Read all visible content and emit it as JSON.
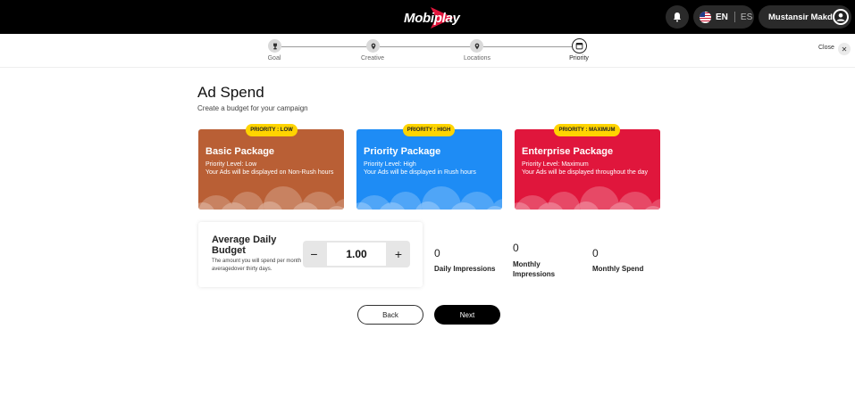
{
  "header": {
    "logo_text": "Mobiplay",
    "notifications_icon": "bell-icon",
    "language": {
      "active": "EN",
      "other": "ES",
      "flag_icon": "us-flag-icon"
    },
    "user": {
      "name": "Mustansir Makda",
      "avatar_icon": "user-avatar-icon"
    }
  },
  "stepper": {
    "steps": [
      {
        "label": "Goal",
        "icon": "trophy-icon",
        "state": "done"
      },
      {
        "label": "Creative",
        "icon": "location-pin-icon",
        "state": "done"
      },
      {
        "label": "Locations",
        "icon": "location-pin-icon",
        "state": "done"
      },
      {
        "label": "Priority",
        "icon": "calendar-icon",
        "state": "active"
      }
    ],
    "close_label": "Close",
    "close_icon": "close-icon"
  },
  "page": {
    "title": "Ad Spend",
    "subtitle": "Create a budget for your campaign"
  },
  "packages": [
    {
      "badge": "PRIORITY : LOW",
      "name": "Basic Package",
      "level": "Priority Level: Low",
      "description": "Your Ads will be displayed on Non-Rush hours",
      "color": "#b95f35"
    },
    {
      "badge": "PRIORITY : HIGH",
      "name": "Priority Package",
      "level": "Priority Level: High",
      "description": "Your Ads will be displayed in Rush hours",
      "color": "#1e8cf5"
    },
    {
      "badge": "PRIORITY : MAXIMUM",
      "name": "Enterprise Package",
      "level": "Priority Level: Maximum",
      "description": "Your Ads will be displayed throughout the day",
      "color": "#e0163c"
    }
  ],
  "budget": {
    "title": "Average Daily Budget",
    "description": "The amount you will spend per month averagedover thirty days.",
    "value": "1.00",
    "minus_label": "−",
    "plus_label": "+"
  },
  "stats": [
    {
      "value": "0",
      "label": "Daily Impressions"
    },
    {
      "value": "0",
      "label": "Monthly Impressions"
    },
    {
      "value": "0",
      "label": "Monthly Spend"
    }
  ],
  "actions": {
    "back_label": "Back",
    "next_label": "Next"
  },
  "colors": {
    "header_bg": "#000000",
    "badge_bg": "#ffd400",
    "primary_button": "#000000"
  }
}
